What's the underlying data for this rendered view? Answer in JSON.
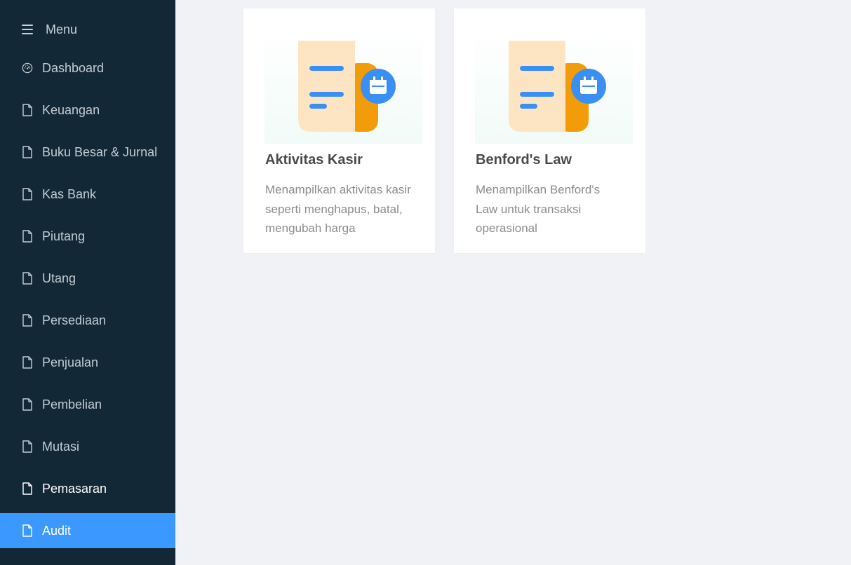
{
  "sidebar": {
    "menu_label": "Menu",
    "items": [
      {
        "label": "Dashboard",
        "icon": "dashboard-icon"
      },
      {
        "label": "Keuangan",
        "icon": "file-icon"
      },
      {
        "label": "Buku Besar & Jurnal",
        "icon": "file-icon"
      },
      {
        "label": "Kas Bank",
        "icon": "file-icon"
      },
      {
        "label": "Piutang",
        "icon": "file-icon"
      },
      {
        "label": "Utang",
        "icon": "file-icon"
      },
      {
        "label": "Persediaan",
        "icon": "file-icon"
      },
      {
        "label": "Penjualan",
        "icon": "file-icon"
      },
      {
        "label": "Pembelian",
        "icon": "file-icon"
      },
      {
        "label": "Mutasi",
        "icon": "file-icon"
      },
      {
        "label": "Pemasaran",
        "icon": "file-icon"
      },
      {
        "label": "Audit",
        "icon": "file-icon"
      }
    ],
    "active_item": "Audit",
    "colors": {
      "background": "#132836",
      "active": "#3a98ff"
    }
  },
  "main": {
    "cards": [
      {
        "title": "Aktivitas Kasir",
        "description": "Menampilkan aktivitas kasir seperti menghapus, batal, mengubah harga",
        "icon": "report-calendar-icon"
      },
      {
        "title": "Benford's Law",
        "description": "Menampilkan Benford's Law untuk transaksi operasional",
        "icon": "report-calendar-icon"
      }
    ]
  }
}
